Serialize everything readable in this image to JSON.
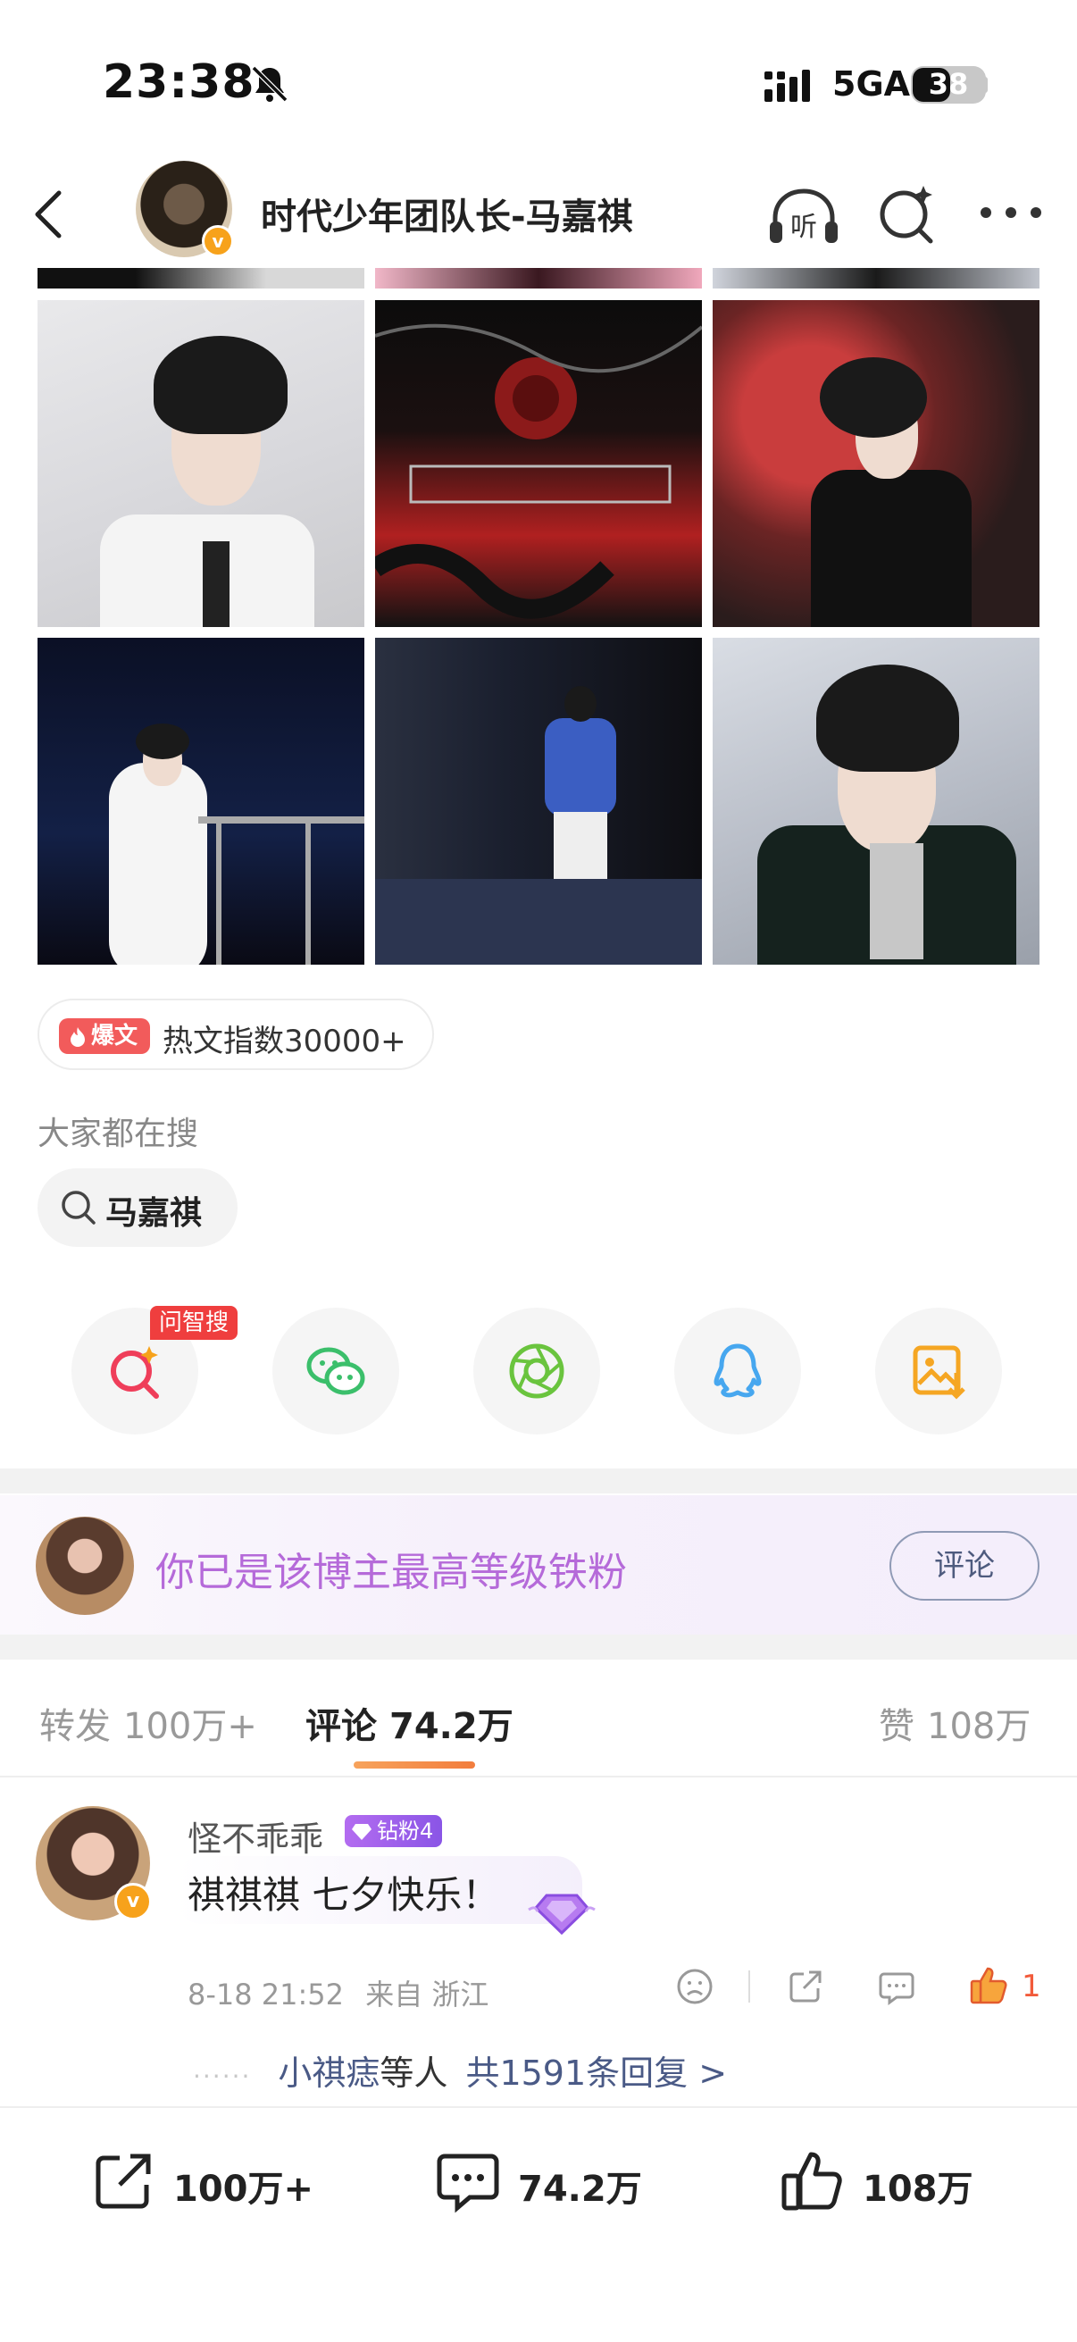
{
  "status_bar": {
    "time": "23:38",
    "network": "5GA",
    "battery": "38"
  },
  "header": {
    "title": "时代少年团队长-马嘉祺"
  },
  "hot_badge": {
    "tag": "爆文",
    "text": "热文指数30000+"
  },
  "search": {
    "hint": "大家都在搜",
    "chip_label": "马嘉祺"
  },
  "share": {
    "ai_tag": "问智搜"
  },
  "fan_banner": {
    "text": "你已是该博主最高等级铁粉",
    "button_label": "评论"
  },
  "tabs": [
    {
      "label": "转发",
      "count": "100万+"
    },
    {
      "label": "评论",
      "count": "74.2万"
    },
    {
      "label": "赞",
      "count": "108万"
    }
  ],
  "comment": {
    "user": "怪不乖乖",
    "badge": "钻粉4",
    "text": "祺祺祺 七夕快乐！",
    "time": "8-18 21:52",
    "location": "来自 浙江",
    "like_count": "1",
    "replies": {
      "dots": "······",
      "name": "小祺痣",
      "by": "等人",
      "total": "共1591条回复 >"
    }
  },
  "bottom_bar": {
    "repost": "100万+",
    "comment": "74.2万",
    "like": "108万"
  },
  "colors": {
    "accent_orange": "#f27d3d",
    "fan_purple": "#b56ad9",
    "hot_red": "#f25b5b",
    "link_blue": "#4a5a86"
  }
}
